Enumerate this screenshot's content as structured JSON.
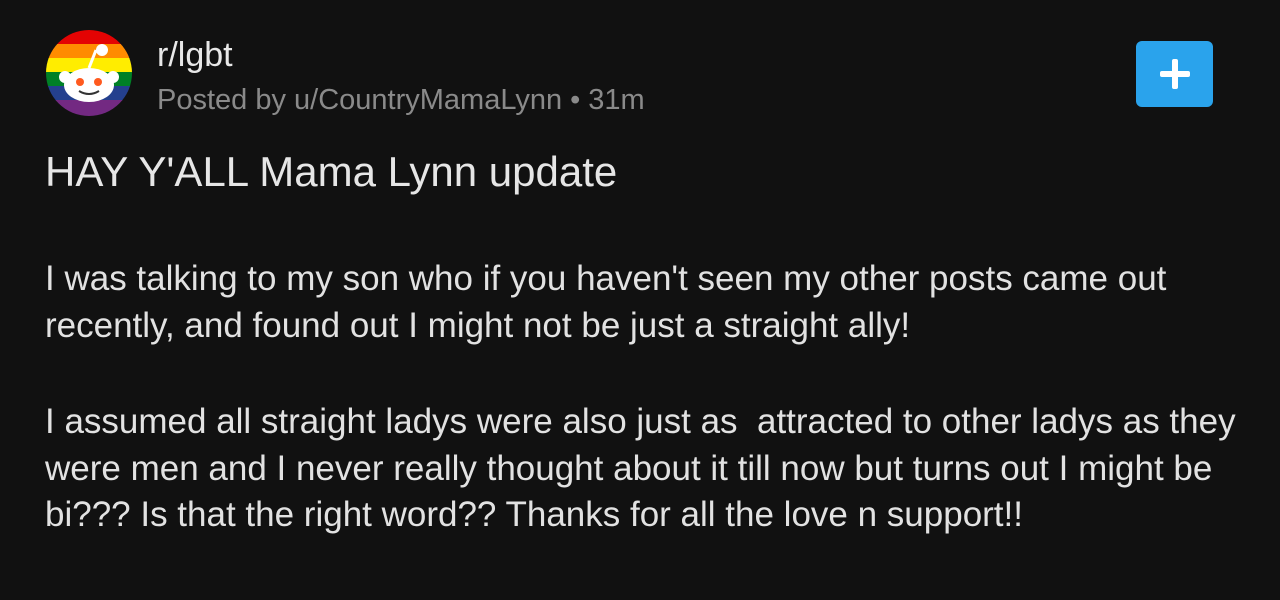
{
  "post": {
    "community": "r/lgbt",
    "meta": {
      "posted_by": "Posted by u/CountryMamaLynn",
      "separator": "•",
      "age": "31m"
    },
    "title": "HAY Y'ALL Mama Lynn update",
    "paragraphs": [
      "I was talking to my son who if you haven't seen my other posts came out recently, and found out I might not be just a straight ally!",
      "I assumed all straight ladys were also just as  attracted to other ladys as they were men and I never really thought about it till now but turns out I might be bi??? Is that the right word?? Thanks for all the love n support!!"
    ],
    "join_button": {
      "icon": "plus-icon"
    }
  },
  "colors": {
    "background": "#111111",
    "text": "#e6e6e6",
    "meta_text": "#8a8a8a",
    "accent": "#2aa3ec",
    "avatar_rainbow": [
      "#e40303",
      "#ff8c00",
      "#ffed00",
      "#008026",
      "#24408e",
      "#732982"
    ]
  }
}
